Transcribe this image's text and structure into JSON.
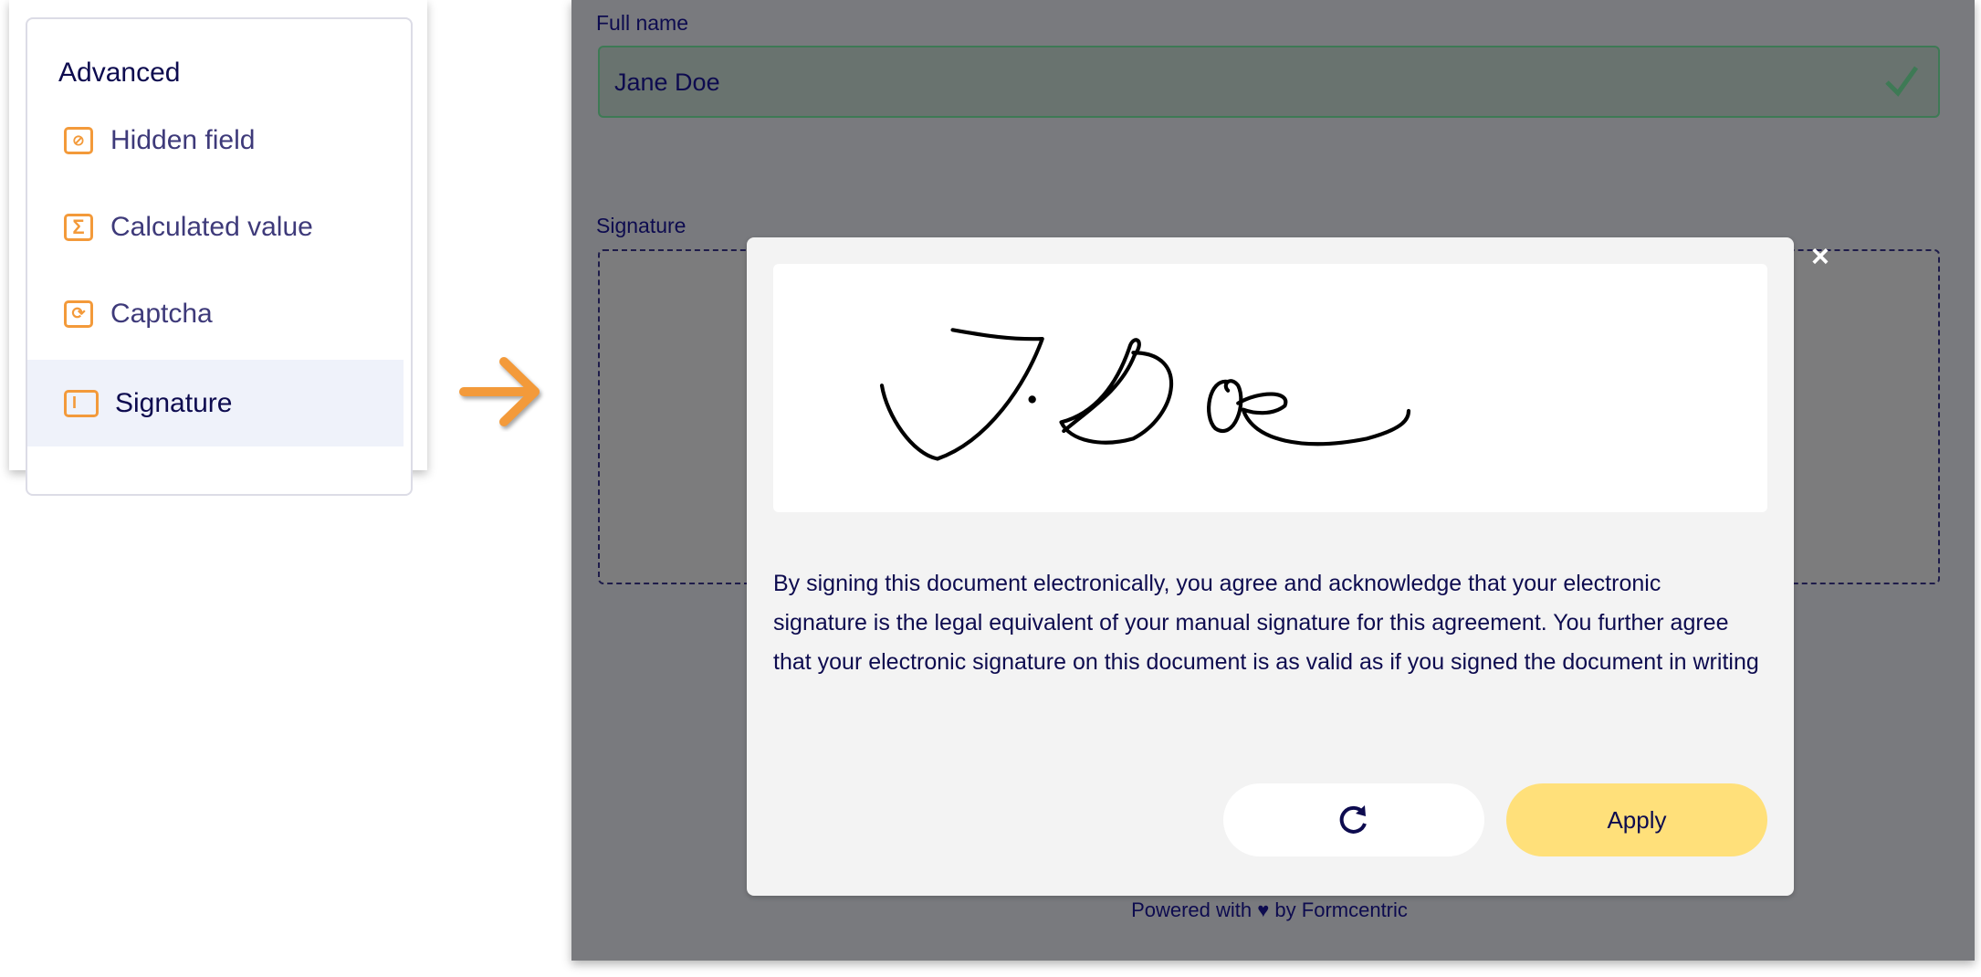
{
  "sidebar": {
    "section_title": "Advanced",
    "items": [
      {
        "label": "Hidden field",
        "icon": "eye-off-icon"
      },
      {
        "label": "Calculated value",
        "icon": "sigma-icon"
      },
      {
        "label": "Captcha",
        "icon": "captcha-icon"
      },
      {
        "label": "Signature",
        "icon": "signature-field-icon",
        "selected": true
      }
    ]
  },
  "form": {
    "full_name_label": "Full name",
    "full_name_value": "Jane Doe",
    "signature_label": "Signature",
    "footer": "Powered with ♥ by Formcentric"
  },
  "modal": {
    "signature_text": "J. Doe",
    "legal_text": "By signing this document electronically, you agree and acknowledge that your electronic signature is the legal equivalent of your manual signature for this agreement. You further agree that your electronic signature on this document is as valid as if you signed the document in writing",
    "reset_icon": "redo-icon",
    "apply_label": "Apply",
    "close_label": "×"
  },
  "colors": {
    "accent": "#f39a3a",
    "apply": "#ffe07a",
    "text": "#0d0b4f",
    "valid": "#3e7a55"
  }
}
